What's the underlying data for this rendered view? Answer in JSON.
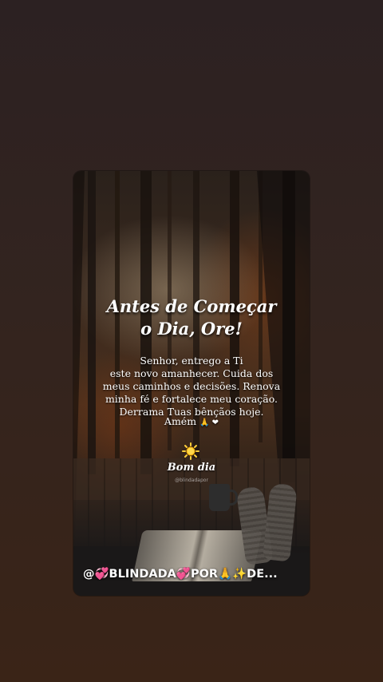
{
  "post": {
    "title_line1": "Antes de Começar",
    "title_line2": "o Dia, Ore!",
    "prayer": "Senhor, entrego a Ti\neste novo amanhecer. Cuida dos\nmeus caminhos e decisões. Renova\nminha fé e fortalece meu coração.\nDerrama Tuas bênçãos hoje.",
    "amen": "Amém",
    "amen_emojis": "🙏 ❤",
    "sun_icon": "sun-icon",
    "greeting": "Bom dia",
    "watermark": "@blindadapor"
  },
  "author": {
    "username": "@💞BLINDADA💞POR🙏✨DE..."
  },
  "colors": {
    "background_top": "#2c2122",
    "background_bottom": "#3a2417",
    "text": "#ffffff"
  }
}
